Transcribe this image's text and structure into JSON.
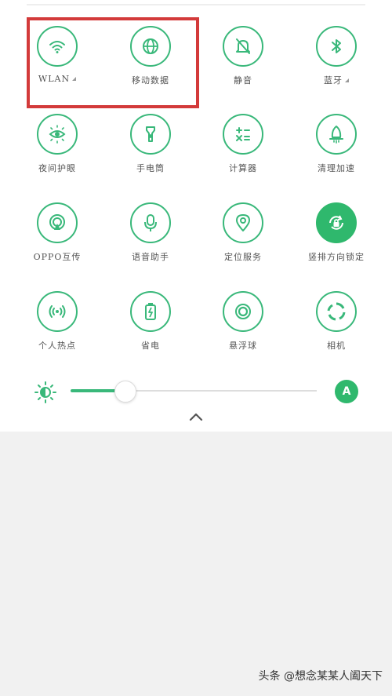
{
  "colors": {
    "accent": "#39b87a",
    "highlight": "#d33a3a",
    "panel_bg": "#ffffff",
    "page_bg": "#f1f1f1"
  },
  "tiles": [
    {
      "label": "WLAN",
      "icon": "wifi-icon",
      "caret": true,
      "active": false
    },
    {
      "label": "移动数据",
      "icon": "globe-icon",
      "caret": false,
      "active": false
    },
    {
      "label": "静音",
      "icon": "bell-mute-icon",
      "caret": false,
      "active": false
    },
    {
      "label": "蓝牙",
      "icon": "bluetooth-icon",
      "caret": true,
      "active": false
    },
    {
      "label": "夜间护眼",
      "icon": "eye-sun-icon",
      "caret": false,
      "active": false
    },
    {
      "label": "手电筒",
      "icon": "flashlight-icon",
      "caret": false,
      "active": false
    },
    {
      "label": "计算器",
      "icon": "calculator-icon",
      "caret": false,
      "active": false
    },
    {
      "label": "清理加速",
      "icon": "rocket-icon",
      "caret": false,
      "active": false
    },
    {
      "label": "OPPO互传",
      "icon": "share-transfer-icon",
      "caret": false,
      "active": false
    },
    {
      "label": "语音助手",
      "icon": "microphone-icon",
      "caret": false,
      "active": false
    },
    {
      "label": "定位服务",
      "icon": "location-pin-icon",
      "caret": false,
      "active": false
    },
    {
      "label": "竖排方向锁定",
      "icon": "rotation-lock-icon",
      "caret": false,
      "active": true
    },
    {
      "label": "个人热点",
      "icon": "hotspot-icon",
      "caret": false,
      "active": false
    },
    {
      "label": "省电",
      "icon": "battery-saver-icon",
      "caret": false,
      "active": false
    },
    {
      "label": "悬浮球",
      "icon": "floating-ball-icon",
      "caret": false,
      "active": false
    },
    {
      "label": "相机",
      "icon": "camera-shutter-icon",
      "caret": false,
      "active": false
    }
  ],
  "brightness": {
    "level": 0.22,
    "auto_label": "A",
    "icon": "brightness-icon"
  },
  "collapse": {
    "icon": "chevron-up-icon"
  },
  "watermark": "头条 @想念某某人阖天下"
}
